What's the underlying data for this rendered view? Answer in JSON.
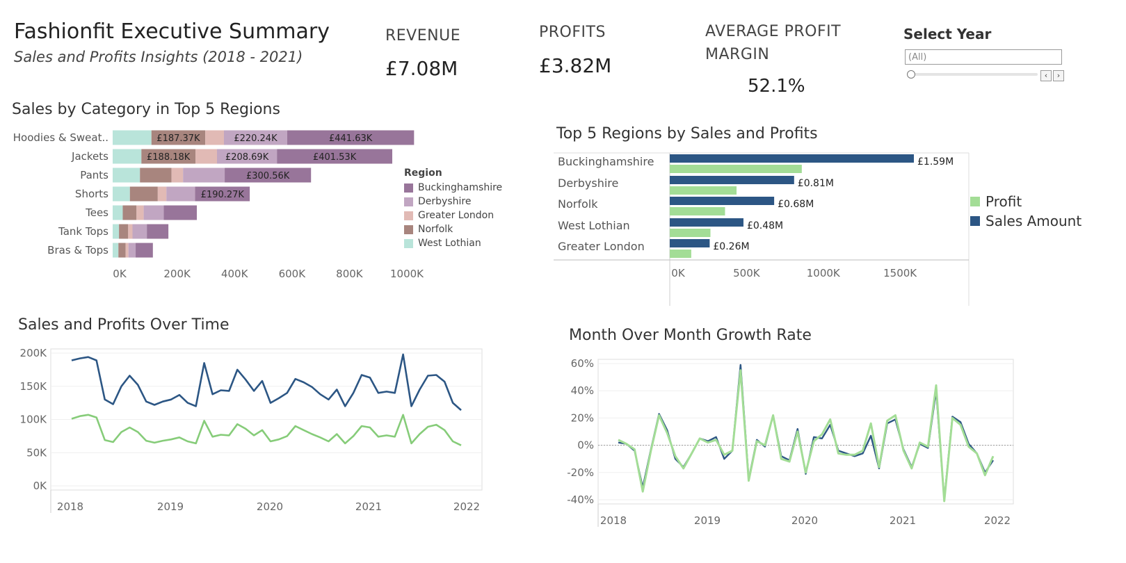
{
  "header": {
    "title": "Fashionfit Executive Summary",
    "subtitle": "Sales and Profits Insights (2018 - 2021)"
  },
  "kpis": {
    "revenue_label": "REVENUE",
    "revenue_value": "£7.08M",
    "profits_label": "PROFITS",
    "profits_value": "£3.82M",
    "margin_label": "AVERAGE PROFIT MARGIN",
    "margin_value": "52.1%"
  },
  "filter": {
    "label": "Select Year",
    "value": "(All)",
    "prev_icon": "chevron-left-icon",
    "next_icon": "chevron-right-icon"
  },
  "colors": {
    "buckinghamshire": "#98759a",
    "derbyshire": "#c1a6c2",
    "greater_london": "#e1bab5",
    "norfolk": "#a8857e",
    "west_lothian": "#b9e4da",
    "sales": "#2c5684",
    "profit": "#a3dd96",
    "profit_line": "#86cc79"
  },
  "chart_data": [
    {
      "type": "bar",
      "stacked": true,
      "orientation": "horizontal",
      "title": "Sales by Category in Top 5 Regions",
      "categories": [
        "Hoodies & Sweat..",
        "Jackets",
        "Pants",
        "Shorts",
        "Tees",
        "Tank Tops",
        "Bras & Tops"
      ],
      "legend_title": "Region",
      "legend_position": "right",
      "series": [
        {
          "name": "West Lothian",
          "values": [
            135,
            100,
            95,
            60,
            35,
            22,
            20
          ],
          "labels": [
            "",
            "",
            "",
            "",
            "",
            "",
            ""
          ]
        },
        {
          "name": "Norfolk",
          "values": [
            187.37,
            188.18,
            110,
            97,
            48,
            32,
            25
          ],
          "labels": [
            "£187.37K",
            "£188.18K",
            "",
            "",
            "",
            "",
            ""
          ]
        },
        {
          "name": "Greater London",
          "values": [
            65,
            75,
            40,
            30,
            25,
            15,
            10
          ],
          "labels": [
            "",
            "",
            "",
            "",
            "",
            "",
            ""
          ]
        },
        {
          "name": "Derbyshire",
          "values": [
            220.24,
            208.69,
            145,
            100,
            70,
            50,
            25
          ],
          "labels": [
            "£220.24K",
            "£208.69K",
            "",
            "",
            "",
            "",
            ""
          ]
        },
        {
          "name": "Buckinghamshire",
          "values": [
            441.63,
            401.53,
            300.56,
            190.27,
            115,
            75,
            60
          ],
          "labels": [
            "£441.63K",
            "£401.53K",
            "£300.56K",
            "£190.27K",
            "",
            "",
            ""
          ]
        }
      ],
      "x_ticks": [
        "0K",
        "200K",
        "400K",
        "600K",
        "800K",
        "1000K"
      ],
      "xlim": [
        0,
        1050
      ]
    },
    {
      "type": "bar",
      "orientation": "horizontal",
      "title": "Top 5 Regions by Sales and Profits",
      "categories": [
        "Buckinghamshire",
        "Derbyshire",
        "Norfolk",
        "West Lothian",
        "Greater London"
      ],
      "series": [
        {
          "name": "Sales Amount",
          "values": [
            1590,
            810,
            680,
            480,
            260
          ],
          "labels": [
            "£1.59M",
            "£0.81M",
            "£0.68M",
            "£0.48M",
            "£0.26M"
          ]
        },
        {
          "name": "Profit",
          "values": [
            860,
            435,
            360,
            265,
            140
          ]
        }
      ],
      "x_ticks": [
        "0K",
        "500K",
        "1000K",
        "1500K"
      ],
      "xlim": [
        0,
        1950
      ],
      "legend_position": "right"
    },
    {
      "type": "line",
      "title": "Sales and Profits Over Time",
      "x_start": "2018-01",
      "x_end": "2021-12",
      "x_ticks": [
        "2018",
        "2019",
        "2020",
        "2021",
        "2022"
      ],
      "y_ticks": [
        "200K",
        "150K",
        "100K",
        "50K",
        "0K"
      ],
      "ylim": [
        0,
        210
      ],
      "series": [
        {
          "name": "Sales Amount",
          "values": [
            189,
            192,
            194,
            189,
            130,
            123,
            150,
            166,
            152,
            127,
            122,
            127,
            130,
            137,
            125,
            120,
            185,
            138,
            144,
            143,
            175,
            160,
            143,
            158,
            125,
            132,
            140,
            161,
            156,
            149,
            138,
            130,
            145,
            120,
            140,
            167,
            163,
            140,
            142,
            140,
            198,
            120,
            145,
            166,
            167,
            157,
            125,
            114
          ]
        },
        {
          "name": "Profit",
          "values": [
            101,
            105,
            107,
            103,
            69,
            66,
            81,
            88,
            81,
            68,
            65,
            68,
            70,
            73,
            67,
            64,
            98,
            74,
            77,
            76,
            93,
            86,
            76,
            84,
            67,
            70,
            75,
            90,
            84,
            78,
            73,
            67,
            78,
            64,
            75,
            90,
            88,
            74,
            76,
            74,
            107,
            64,
            78,
            89,
            92,
            84,
            67,
            61
          ]
        }
      ],
      "grid": true
    },
    {
      "type": "line",
      "title": "Month Over Month Growth Rate",
      "x_start": "2018-02",
      "x_end": "2021-12",
      "x_ticks": [
        "2018",
        "2019",
        "2020",
        "2021",
        "2022"
      ],
      "y_ticks": [
        "60%",
        "40%",
        "20%",
        "0%",
        "-20%",
        "-40%"
      ],
      "ylim": [
        -45,
        62
      ],
      "series": [
        {
          "name": "Sales Amount",
          "values": [
            2,
            1,
            -4,
            -31,
            -3,
            23,
            11,
            -10,
            -16,
            -6,
            5,
            3,
            6,
            -10,
            -4,
            59,
            -25,
            4,
            -1,
            22,
            -8,
            -11,
            12,
            -21,
            6,
            5,
            15,
            -4,
            -6,
            -8,
            -6,
            7,
            -17,
            16,
            19,
            -3,
            -16,
            1,
            -2,
            40,
            -40,
            21,
            17,
            1,
            -6,
            -20,
            -11
          ]
        },
        {
          "name": "Profit",
          "values": [
            4,
            1,
            -3,
            -34,
            -4,
            22,
            9,
            -8,
            -17,
            -6,
            5,
            2,
            4,
            -7,
            -4,
            55,
            -26,
            3,
            0,
            22,
            -10,
            -12,
            10,
            -20,
            3,
            8,
            19,
            -6,
            -7,
            -7,
            -4,
            16,
            -16,
            18,
            22,
            -4,
            -17,
            2,
            -1,
            44,
            -41,
            20,
            15,
            -1,
            -6,
            -22,
            -8
          ]
        }
      ],
      "zero_line": true,
      "grid": true
    }
  ]
}
